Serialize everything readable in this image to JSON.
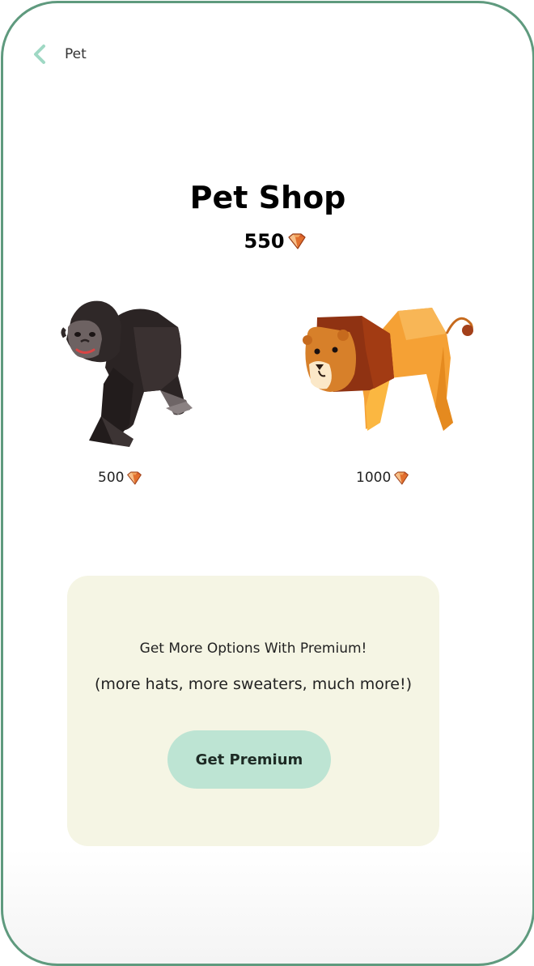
{
  "header": {
    "back_icon": "chevron-left-icon",
    "title": "Pet"
  },
  "shop": {
    "title": "Pet Shop",
    "balance": "550",
    "currency_icon": "gem-icon"
  },
  "pets": [
    {
      "name": "gorilla",
      "price": "500"
    },
    {
      "name": "lion",
      "price": "1000"
    }
  ],
  "premium": {
    "heading": "Get More Options With Premium!",
    "subtext": "(more hats, more sweaters, much more!)",
    "button_label": "Get Premium"
  },
  "colors": {
    "frame": "#5f9a7e",
    "accent": "#bde4d3",
    "panel": "#f5f5e4",
    "back_icon": "#9fd8c4"
  }
}
